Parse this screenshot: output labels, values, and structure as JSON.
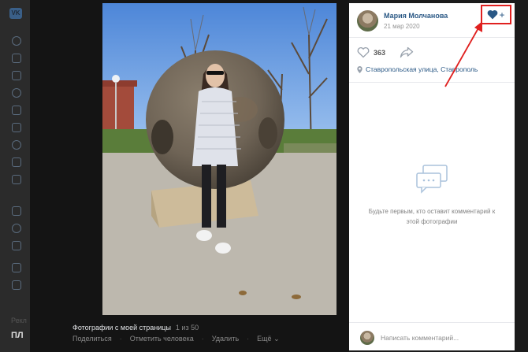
{
  "background": {
    "bottom_text": "Рекл",
    "bottom_label": "ПЛ"
  },
  "viewer": {
    "album_title": "Фотографии с моей страницы",
    "counter": "1 из 50",
    "actions": {
      "share": "Поделиться",
      "tag": "Отметить человека",
      "delete": "Удалить",
      "more": "Ещё"
    }
  },
  "panel": {
    "author": "Мария Молчанова",
    "date": "21 мар 2020",
    "likes": "363",
    "location": "Ставропольская улица, Ставрополь",
    "empty_text": "Будьте первым, кто оставит комментарий к этой фотографии",
    "comment_placeholder": "Написать комментарий..."
  },
  "icons": {
    "favorite": "heart-plus-icon",
    "like": "heart-outline-icon",
    "share": "share-arrow-icon",
    "location": "pin-icon",
    "comments": "chat-bubbles-icon"
  },
  "colors": {
    "link": "#2a5885",
    "highlight": "#e0201f",
    "panel_bg": "#ffffff",
    "viewer_bg": "#141414"
  }
}
